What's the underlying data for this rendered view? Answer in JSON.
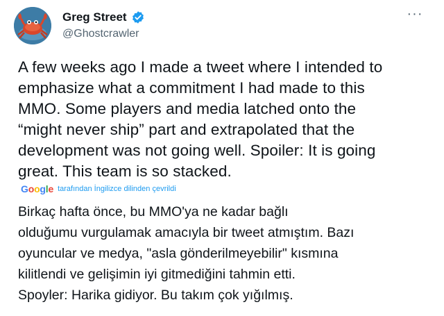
{
  "author": {
    "display_name": "Greg Street",
    "handle": "@Ghostcrawler",
    "verified": true,
    "avatar_icon": "crab-avatar-icon"
  },
  "more_menu_label": "···",
  "tweet": {
    "text": "A few weeks ago I made a tweet where I intended to\nemphasize what a commitment I had made to this\nMMO. Some players and media latched onto the\n“might never ship” part and extrapolated that the\ndevelopment was not going well. Spoiler: It is going\ngreat. This team is so stacked."
  },
  "translation": {
    "provider": "Google",
    "note": "tarafından İngilizce dilinden çevrildi",
    "text": "Birkaç hafta önce, bu MMO'ya ne kadar bağlı\nolduğumu vurgulamak amacıyla bir tweet atmıştım. Bazı\noyuncular ve medya, \"asla gönderilmeyebilir\" kısmına\nkilitlendi ve gelişimin iyi gitmediğini tahmin etti.\nSpoyler: Harika gidiyor. Bu takım çok yığılmış."
  },
  "colors": {
    "text": "#0f1419",
    "secondary": "#536471",
    "accent": "#1d9bf0",
    "verified": "#1d9bf0"
  }
}
